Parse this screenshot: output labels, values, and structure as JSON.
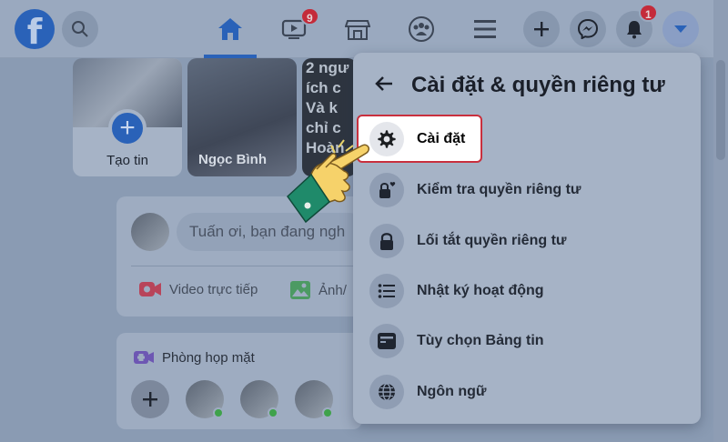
{
  "topbar": {
    "logo": "f",
    "watch_badge": "9",
    "notif_badge": "1"
  },
  "stories": {
    "create_label": "Tạo tin",
    "friend_label": "Ngọc Bình",
    "third_lines": [
      "2 ngư",
      "ích c",
      "Và k",
      "chỉ c",
      "Hoàn"
    ]
  },
  "composer": {
    "placeholder": "Tuấn ơi, bạn đang ngh",
    "live_label": "Video trực tiếp",
    "photo_label": "Ảnh/"
  },
  "rooms": {
    "title": "Phòng họp mặt"
  },
  "settings_menu": {
    "title": "Cài đặt & quyền riêng tư",
    "items": [
      {
        "label": "Cài đặt",
        "icon": "gear-icon"
      },
      {
        "label": "Kiểm tra quyền riêng tư",
        "icon": "lock-heart-icon"
      },
      {
        "label": "Lối tắt quyền riêng tư",
        "icon": "lock-icon"
      },
      {
        "label": "Nhật ký hoạt động",
        "icon": "list-icon"
      },
      {
        "label": "Tùy chọn Bảng tin",
        "icon": "feed-icon"
      },
      {
        "label": "Ngôn ngữ",
        "icon": "globe-icon"
      }
    ]
  },
  "colors": {
    "highlight_border": "#c9303e",
    "brand_blue": "#2a62b8",
    "hand_skin": "#f6d26a",
    "hand_sleeve": "#1f8a6a"
  }
}
